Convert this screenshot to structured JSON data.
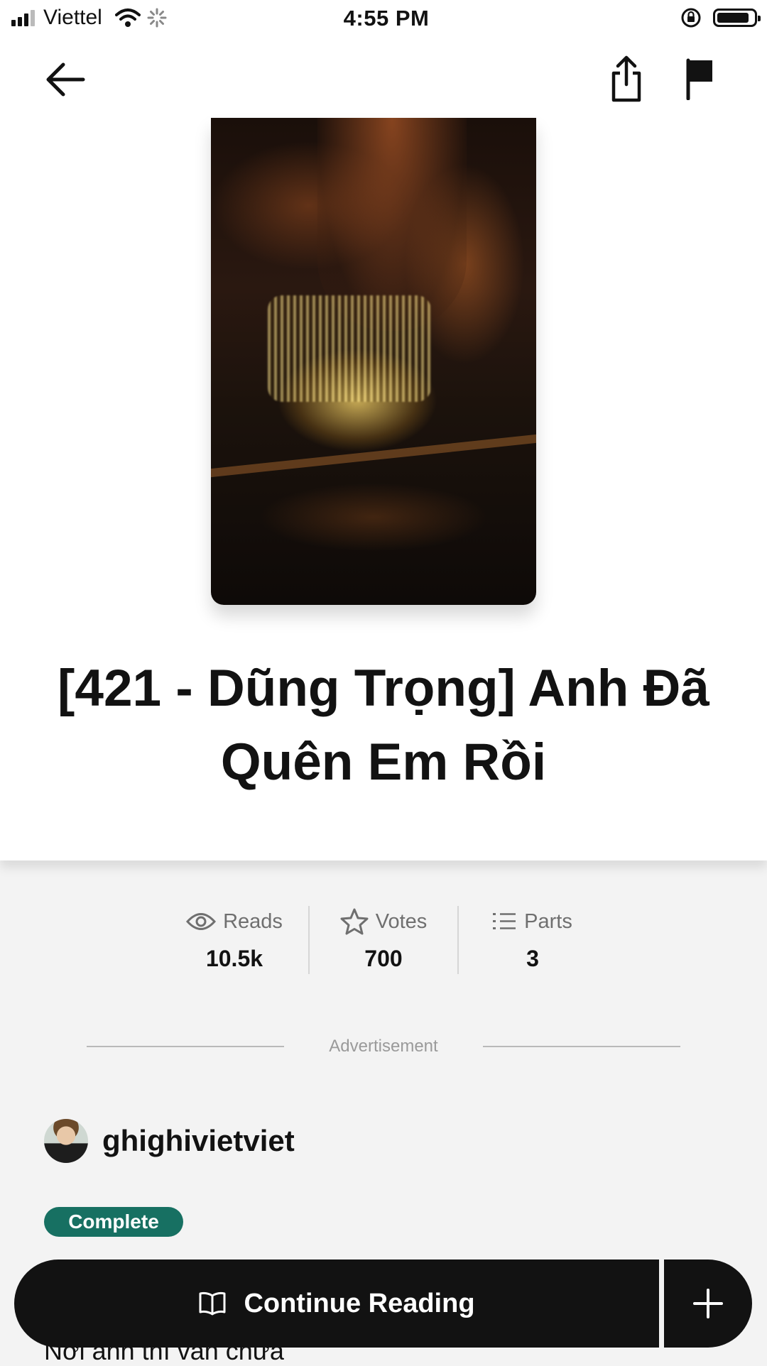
{
  "status_bar": {
    "carrier": "Viettel",
    "time": "4:55 PM"
  },
  "story": {
    "title": "[421 - Dũng Trọng] Anh Đã Quên Em Rồi",
    "description_start": "Nơi anh thì vẫn chưa"
  },
  "stats": {
    "reads": {
      "label": "Reads",
      "value": "10.5k"
    },
    "votes": {
      "label": "Votes",
      "value": "700"
    },
    "parts": {
      "label": "Parts",
      "value": "3"
    }
  },
  "ad_label": "Advertisement",
  "author": {
    "name": "ghighivietviet"
  },
  "status_badge": "Complete",
  "bottom_bar": {
    "continue_label": "Continue Reading"
  },
  "colors": {
    "badge": "#177062",
    "cta": "#121212"
  }
}
